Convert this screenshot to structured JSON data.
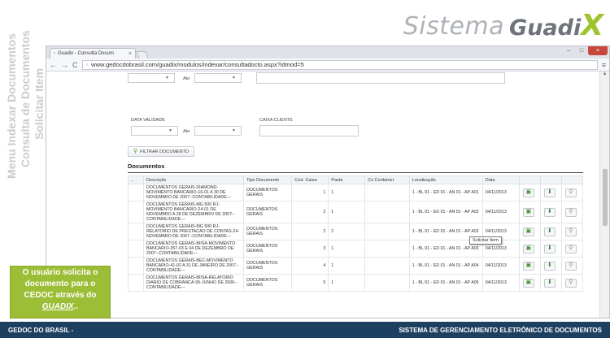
{
  "logo": {
    "word1": "Sistema",
    "word2": "Guadi",
    "word3": "X"
  },
  "side_titles": [
    "Menu Indexar Documentos",
    "Consulta de Documentos",
    "Solicitar Item"
  ],
  "browser": {
    "tab_title": "Guadix - Consulta Docum",
    "url": "www.gedocdobrasil.com/guadix/modulos/indexar/consultadocto.aspx?idmod=5",
    "minimize": "–",
    "maximize": "□",
    "close": "×"
  },
  "form": {
    "ate_label": "Ate",
    "data_validade_label": "DATA VALIDADE",
    "caixa_cliente_label": "CAIXA CLIENTE",
    "filter_button": "FILTRAR DOCUMENTO"
  },
  "documents": {
    "title": "Documentos",
    "columns": [
      "...",
      "Descrição",
      "Tipo Documento",
      "Cod. Caixa",
      "Pasta",
      "Cx Container",
      "Localização",
      "Data"
    ],
    "rows": [
      {
        "desc": "DOCUMENTOS GERAIS-DIAMOND-MOVIMENTO BANCARIO-16-01 A 30 DE NOVEMBRO DE 2007--CONTABILIDADE---",
        "tipo": "DOCUMENTOS GERAIS",
        "caixa": "1",
        "pasta": "1",
        "container": "",
        "loc": "1 - BL 01 - ED 01 - AN 01 - AP A01",
        "data": "04/11/2013"
      },
      {
        "desc": "DOCUMENTOS GERAIS-MG 500 RJ-MOVIMENTO BANCARIO-24-01 DE NOVEMBRO A 28 DE DEZEMBRO DE 2007--CONTABILIDADE---",
        "tipo": "DOCUMENTOS GERAIS",
        "caixa": "2",
        "pasta": "1",
        "container": "",
        "loc": "1 - BL 01 - ED 01 - AN 01 - AP A02",
        "data": "04/11/2013"
      },
      {
        "desc": "DOCUMENTOS GERAIS-MG 500 RJ-RELATORIO DE PRESTACAO DE CONTAS-24-NOVEMBRO DE 2007--CONTABILIDADE---",
        "tipo": "DOCUMENTOS GERAIS",
        "caixa": "2",
        "pasta": "2",
        "container": "",
        "loc": "1 - BL 01 - ED 01 - AN 01 - AP A02",
        "data": "04/11/2013"
      },
      {
        "desc": "DOCUMENTOS GERAIS-BIISA-MOVIMENTO BANCARIO-357-03 E 04 DE DEZEMBRO DE 2007--CONTABILIDADE---",
        "tipo": "DOCUMENTOS GERAIS",
        "caixa": "3",
        "pasta": "1",
        "container": "",
        "loc": "1 - BL 01 - ED 01 - AN 01 - AP A03",
        "data": "04/11/2013"
      },
      {
        "desc": "DOCUMENTOS GERAIS-BEC-MOVIMENTO BANCARIO-41-02 A 31 DE JANEIRO DE 2007--CONTABILIDADE---",
        "tipo": "DOCUMENTOS GERAIS",
        "caixa": "4",
        "pasta": "1",
        "container": "",
        "loc": "1 - BL 01 - ED 01 - AN 01 - AP A04",
        "data": "04/11/2013"
      },
      {
        "desc": "DOCUMENTOS GERAIS-BIISA-RELATORIO DIARIO DE COBRANCA-95-JUNHO DE 2006--CONTABILIDADE---",
        "tipo": "DOCUMENTOS GERAIS",
        "caixa": "5",
        "pasta": "1",
        "container": "",
        "loc": "1 - BL 01 - ED 01 - AN 01 - AP A05",
        "data": "04/11/2013"
      }
    ],
    "tooltip": "Solicitar Item"
  },
  "callout": {
    "text": "O usuário solicita o documento para o CEDOC através do",
    "emph": "GUADIX",
    "tail": ".."
  },
  "footer": {
    "left": "GEDOC DO BRASIL -",
    "right": "SISTEMA DE GERENCIAMENTO ELETRÔNICO DE DOCUMENTOS"
  },
  "colors": {
    "accent": "#9cbd36",
    "footer_bg": "#1e4060"
  },
  "icons": {
    "view": "document-view-icon",
    "download": "download-icon",
    "search": "magnifier-icon"
  }
}
